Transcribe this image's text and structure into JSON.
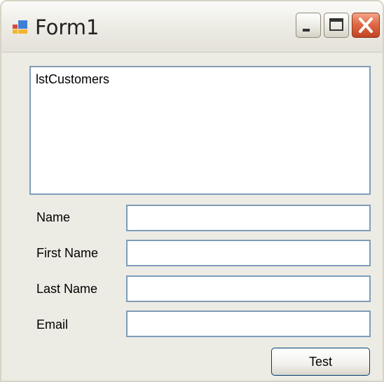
{
  "window": {
    "title": "Form1",
    "icon": "app-form-icon",
    "controls": [
      "minimize-icon",
      "maximize-icon",
      "close-icon"
    ]
  },
  "listbox": {
    "text": "lstCustomers"
  },
  "fields": [
    {
      "label": "Name",
      "value": ""
    },
    {
      "label": "First Name",
      "value": ""
    },
    {
      "label": "Last Name",
      "value": ""
    },
    {
      "label": "Email",
      "value": ""
    }
  ],
  "buttons": {
    "test_label": "Test"
  },
  "colors": {
    "close_button": "#e06a45",
    "field_border": "#7f9db9",
    "window_bg": "#ecebe4"
  }
}
